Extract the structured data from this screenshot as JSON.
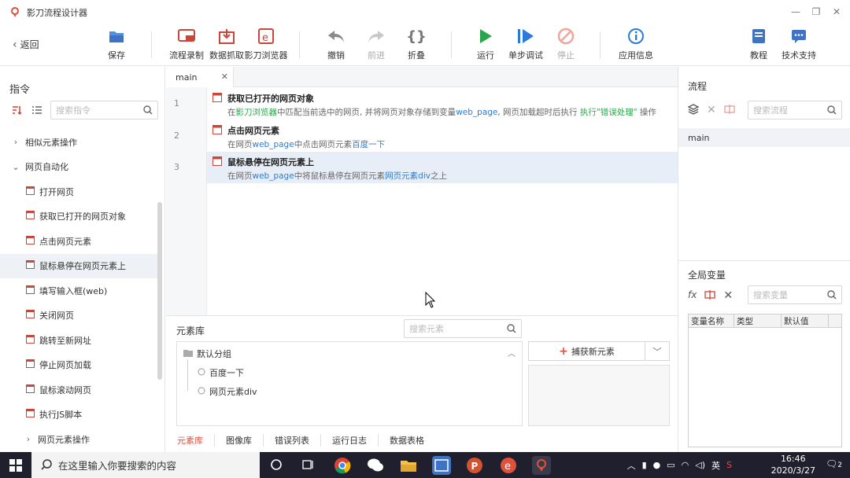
{
  "app": {
    "title": "影刀流程设计器"
  },
  "toolbar": {
    "back": "返回",
    "save": "保存",
    "record": "流程录制",
    "scrape": "数据抓取",
    "browser": "影刀浏览器",
    "undo": "撤销",
    "redo": "前进",
    "fold": "折叠",
    "run": "运行",
    "step_debug": "单步调试",
    "stop": "停止",
    "app_info": "应用信息",
    "tutorial": "教程",
    "support": "技术支持"
  },
  "left": {
    "title": "指令",
    "search_placeholder": "搜索指令",
    "tree": [
      {
        "label": "相似元素操作",
        "kind": "group-collapsed"
      },
      {
        "label": "网页自动化",
        "kind": "group-expanded"
      },
      {
        "label": "打开网页",
        "kind": "item"
      },
      {
        "label": "获取已打开的网页对象",
        "kind": "item"
      },
      {
        "label": "点击网页元素",
        "kind": "item"
      },
      {
        "label": "鼠标悬停在网页元素上",
        "kind": "item-selected"
      },
      {
        "label": "填写输入框(web)",
        "kind": "item"
      },
      {
        "label": "关闭网页",
        "kind": "item"
      },
      {
        "label": "跳转至新网址",
        "kind": "item"
      },
      {
        "label": "停止网页加载",
        "kind": "item"
      },
      {
        "label": "鼠标滚动网页",
        "kind": "item"
      },
      {
        "label": "执行JS脚本",
        "kind": "item"
      },
      {
        "label": "网页元素操作",
        "kind": "subgroup-collapsed"
      }
    ]
  },
  "editor": {
    "tab": "main",
    "steps": [
      {
        "num": "1",
        "title": "获取已打开的网页对象",
        "d1": "在",
        "d2": "影刀浏览器",
        "d3": "中匹配当前选中的网页, 并将网页对象存储到变量",
        "d4": "web_page",
        "d5": ", 网页加载超时后执行 ",
        "d6": "执行\"错误处理\"",
        "d7": " 操作"
      },
      {
        "num": "2",
        "title": "点击网页元素",
        "d1": "在网页",
        "d2": "web_page",
        "d3": "中点击网页元素",
        "d4": "百度一下"
      },
      {
        "num": "3",
        "title": "鼠标悬停在网页元素上",
        "d1": "在网页",
        "d2": "web_page",
        "d3": "中将鼠标悬停在网页元素",
        "d4": "网页元素div",
        "d5": "之上"
      }
    ]
  },
  "elements": {
    "title": "元素库",
    "search_placeholder": "搜索元素",
    "group": "默认分组",
    "items": [
      "百度一下",
      "网页元素div"
    ],
    "capture": "捕获新元素",
    "bottom_tabs": [
      "元素库",
      "图像库",
      "错误列表",
      "运行日志",
      "数据表格"
    ]
  },
  "right": {
    "flow_title": "流程",
    "flow_search_placeholder": "搜索流程",
    "flows": [
      "main"
    ],
    "vars_title": "全局变量",
    "vars_search_placeholder": "搜索变量",
    "var_cols": [
      "变量名称",
      "类型",
      "默认值"
    ]
  },
  "taskbar": {
    "search_placeholder": "在这里输入你要搜索的内容",
    "ime": "英",
    "time": "16:46",
    "date": "2020/3/27",
    "notifications": "2"
  },
  "colors": {
    "accent": "#e0513c",
    "green": "#2aa54a",
    "blue": "#2b7bd6",
    "selected": "#e8eef7"
  }
}
